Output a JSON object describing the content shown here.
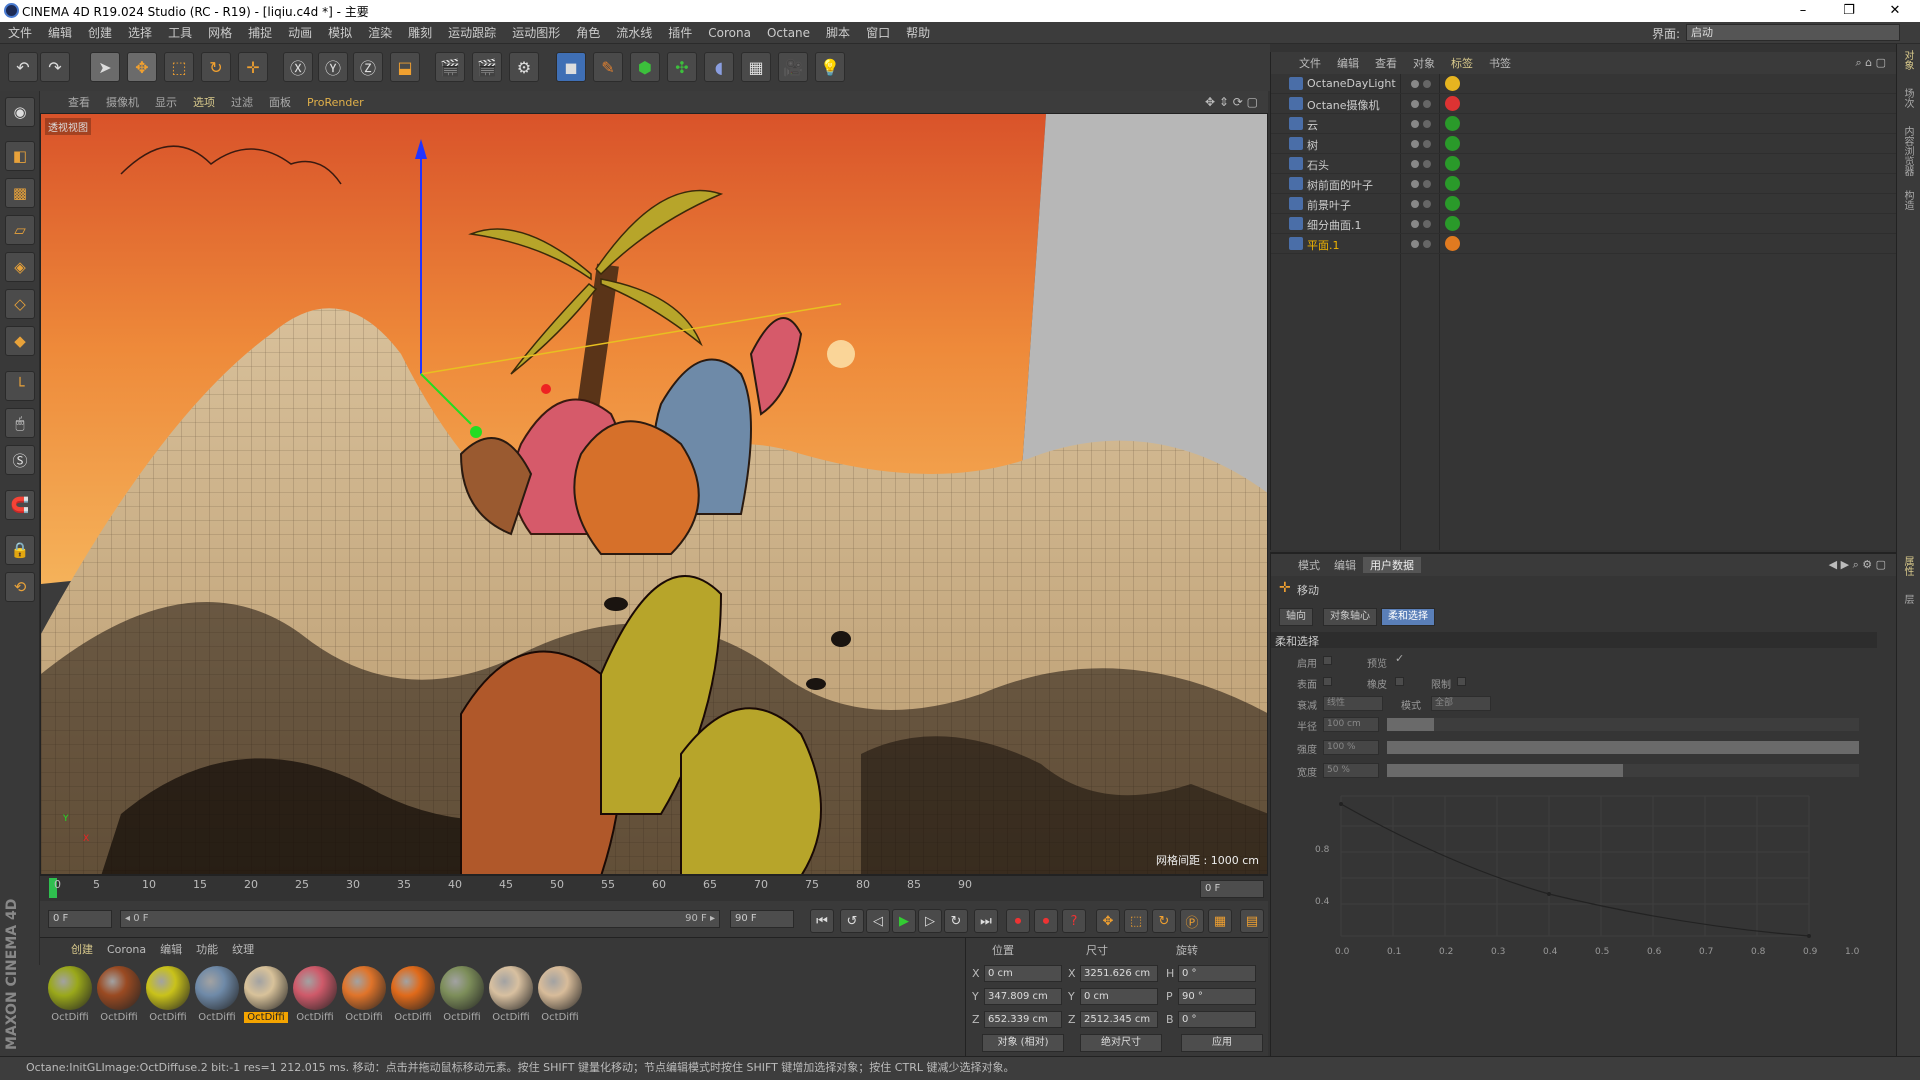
{
  "window": {
    "title": "CINEMA 4D R19.024 Studio (RC - R19) - [liqiu.c4d *] - 主要",
    "min": "–",
    "max": "❐",
    "close": "✕"
  },
  "menu": {
    "items": [
      "文件",
      "编辑",
      "创建",
      "选择",
      "工具",
      "网格",
      "捕捉",
      "动画",
      "模拟",
      "渲染",
      "雕刻",
      "运动跟踪",
      "运动图形",
      "角色",
      "流水线",
      "插件",
      "Corona",
      "Octane",
      "脚本",
      "窗口",
      "帮助"
    ],
    "layout_label": "界面:",
    "layout_value": "启动"
  },
  "viewport": {
    "menu": [
      "查看",
      "摄像机",
      "显示",
      "选项",
      "过滤",
      "面板",
      "ProRender"
    ],
    "label": "透视视图",
    "grid_spacing": "网格间距 : 1000 cm",
    "axis_y": "Y",
    "axis_x": "X"
  },
  "timeline": {
    "ticks": [
      "0",
      "5",
      "10",
      "15",
      "20",
      "25",
      "30",
      "35",
      "40",
      "45",
      "50",
      "55",
      "60",
      "65",
      "70",
      "75",
      "80",
      "85",
      "90"
    ],
    "current_frame": "0 F"
  },
  "playback": {
    "start": "0 F",
    "range_start": "◂ 0 F",
    "range_end": "90 F ▸",
    "end": "90 F"
  },
  "materials": {
    "menu": [
      "创建",
      "Corona",
      "编辑",
      "功能",
      "纹理"
    ],
    "items": [
      {
        "label": "OctDiffi",
        "color": "#9aa81a"
      },
      {
        "label": "OctDiffi",
        "color": "#9a4a22"
      },
      {
        "label": "OctDiffi",
        "color": "#c9c21a"
      },
      {
        "label": "OctDiffi",
        "color": "#6f8aa8"
      },
      {
        "label": "OctDiffi",
        "color": "#d8c29a",
        "active": true
      },
      {
        "label": "OctDiffi",
        "color": "#cf5a6a"
      },
      {
        "label": "OctDiffi",
        "color": "#e0742a"
      },
      {
        "label": "OctDiffi",
        "color": "#e06a1a"
      },
      {
        "label": "OctDiffi",
        "color": "#7d8e5a"
      },
      {
        "label": "OctDiffi",
        "color": "#d8c0a0"
      },
      {
        "label": "OctDiffi",
        "color": "#d8bc9a"
      }
    ]
  },
  "coords": {
    "headers": {
      "pos": "位置",
      "size": "尺寸",
      "rot": "旋转"
    },
    "rows": [
      {
        "axis": "X",
        "pos": "0 cm",
        "size": "3251.626 cm",
        "rl": "H",
        "rot": "0 °"
      },
      {
        "axis": "Y",
        "pos": "347.809 cm",
        "size": "0 cm",
        "rl": "P",
        "rot": "90 °"
      },
      {
        "axis": "Z",
        "pos": "652.339 cm",
        "size": "2512.345 cm",
        "rl": "B",
        "rot": "0 °"
      }
    ],
    "mode": "对象 (相对)",
    "size_mode": "绝对尺寸",
    "apply": "应用"
  },
  "objects": {
    "menu": [
      "文件",
      "编辑",
      "查看",
      "对象",
      "标签",
      "书签"
    ],
    "rows": [
      {
        "name": "OctaneDayLight",
        "tag": "#e6b420"
      },
      {
        "name": "Octane摄像机",
        "tag": "#d33"
      },
      {
        "name": "云",
        "tag": "#2a9a2a"
      },
      {
        "name": "树",
        "tag": "#2a9a2a"
      },
      {
        "name": "石头",
        "tag": "#2a9a2a"
      },
      {
        "name": "树前面的叶子",
        "tag": "#2a9a2a"
      },
      {
        "name": "前景叶子",
        "tag": "#2a9a2a"
      },
      {
        "name": "细分曲面.1",
        "tag": "#2a9a2a"
      },
      {
        "name": "平面.1",
        "tag": "#e07a20",
        "selected": true
      }
    ]
  },
  "attributes": {
    "menu": [
      "模式",
      "编辑",
      "用户数据"
    ],
    "tool_name": "移动",
    "tabs": [
      "轴向",
      "对象轴心",
      "柔和选择"
    ],
    "section": "柔和选择",
    "enable": "启用",
    "preview": "预览",
    "surface": "表面",
    "rubber": "橡皮",
    "limit": "限制",
    "falloff": "衰减",
    "falloff_val": "线性",
    "mode": "模式",
    "mode_val": "全部",
    "radius": "半径",
    "radius_val": "100 cm",
    "strength": "强度",
    "strength_val": "100 %",
    "width": "宽度",
    "width_val": "50 %",
    "graph_y": [
      "0.8",
      "0.4"
    ],
    "graph_x": [
      "0.0",
      "0.1",
      "0.2",
      "0.3",
      "0.4",
      "0.5",
      "0.6",
      "0.7",
      "0.8",
      "0.9",
      "1.0"
    ],
    "radius_fill": 0.1,
    "strength_fill": 1.0,
    "width_fill": 0.5
  },
  "right_strip": [
    "对象",
    "场次",
    "内容浏览器",
    "构造",
    "属性",
    "层"
  ],
  "status": "Octane:InitGLImage:OctDiffuse.2  bit:-1 res=1  212.015 ms.     移动：点击并拖动鼠标移动元素。按住 SHIFT 键量化移动；节点编辑模式时按住 SHIFT 键增加选择对象；按住 CTRL 键减少选择对象。"
}
